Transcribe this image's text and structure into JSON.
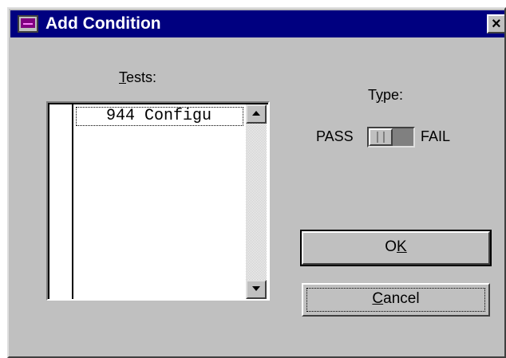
{
  "window": {
    "title": "Add Condition",
    "close_glyph": "×",
    "icon": "app-window-icon"
  },
  "tests": {
    "label_access": "T",
    "label_rest": "ests:",
    "items": [
      "944 Configu"
    ]
  },
  "type": {
    "label_pre": "T",
    "label_access": "y",
    "label_post": "pe:",
    "pass_label": "PASS",
    "fail_label": "FAIL",
    "value": "PASS"
  },
  "buttons": {
    "ok_pre": "O",
    "ok_access": "K",
    "cancel_access": "C",
    "cancel_rest": "ancel"
  },
  "colors": {
    "titlebar": "#000080",
    "face": "#c0c0c0"
  }
}
